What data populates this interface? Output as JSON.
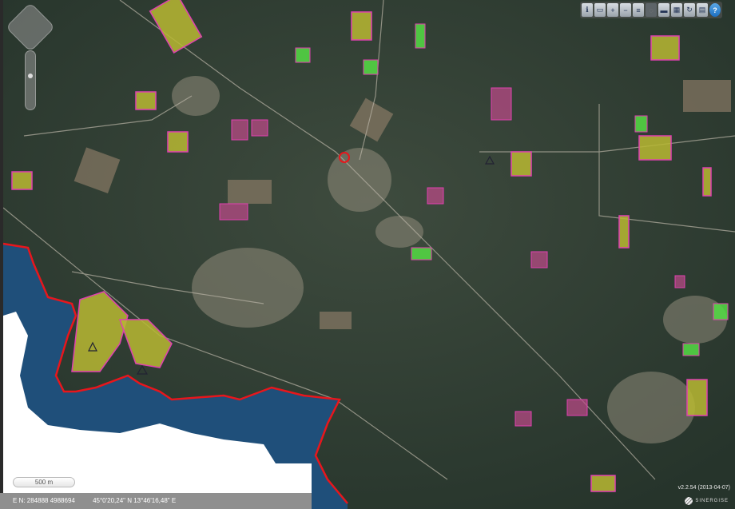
{
  "toolbar": {
    "buttons": [
      {
        "name": "info-icon",
        "label": "ℹ"
      },
      {
        "name": "print-area-icon",
        "label": "▭"
      },
      {
        "name": "zoom-in-icon",
        "label": "+"
      },
      {
        "name": "zoom-out-icon",
        "label": "−"
      },
      {
        "name": "layers-icon",
        "label": "≡"
      },
      {
        "name": "disabled-tool-icon",
        "label": "◌"
      },
      {
        "name": "measure-distance-icon",
        "label": "▬"
      },
      {
        "name": "measure-area-icon",
        "label": "▦"
      },
      {
        "name": "refresh-icon",
        "label": "↻"
      },
      {
        "name": "printer-icon",
        "label": "▤"
      },
      {
        "name": "help-icon",
        "label": "?"
      }
    ]
  },
  "scale": {
    "label": "500 m"
  },
  "status": {
    "projected": "E N: 284888 4988694",
    "geographic": "45°0'20,24\" N 13°46'16,48\" E"
  },
  "footer": {
    "version": "v2.2.54 (2013-04-07)",
    "brand": "SINERGISE"
  },
  "colors": {
    "coast": "#e8161c",
    "parcel_fill": "#b8b832",
    "parcel_border": "#e040b0",
    "meadow": "#55dd44",
    "sea": "#1f4f7a"
  }
}
